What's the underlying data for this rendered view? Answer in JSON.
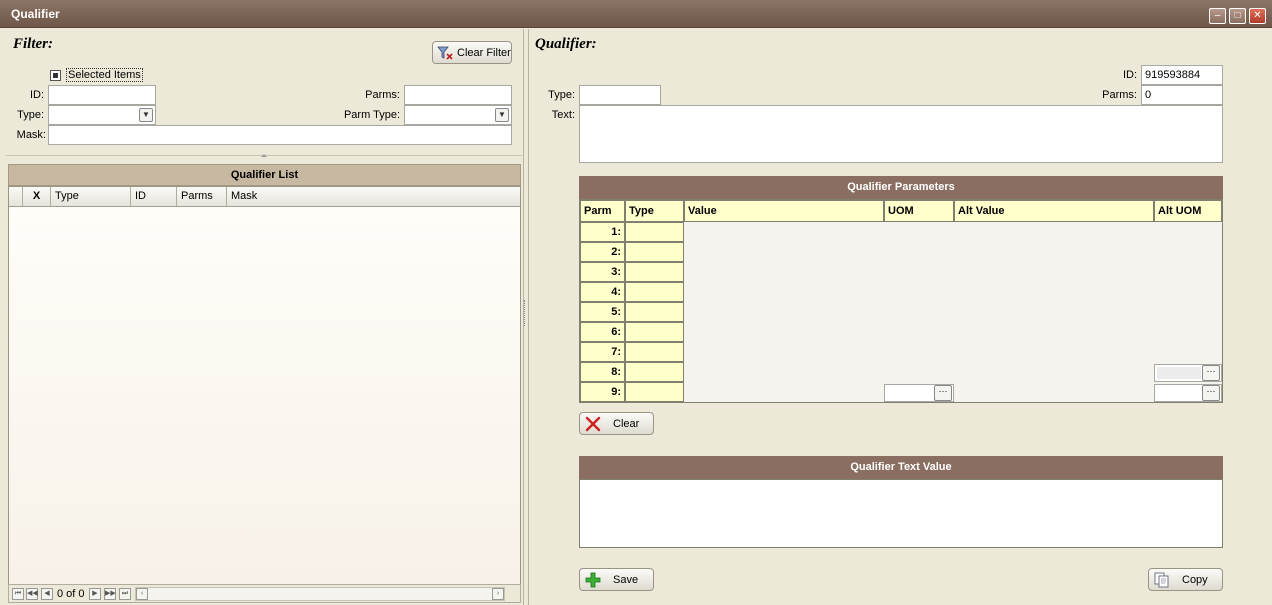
{
  "window": {
    "title": "Qualifier"
  },
  "filter": {
    "heading": "Filter:",
    "clear_filter_label": "Clear Filter",
    "selected_items_label": "Selected Items",
    "id_label": "ID:",
    "type_label": "Type:",
    "mask_label": "Mask:",
    "parms_label": "Parms:",
    "parm_type_label": "Parm Type:",
    "id_value": "",
    "type_value": "",
    "mask_value": "",
    "parms_value": "",
    "parm_type_value": ""
  },
  "qualifier_list": {
    "title": "Qualifier List",
    "columns": [
      "X",
      "Type",
      "ID",
      "Parms",
      "Mask"
    ],
    "rows": [],
    "pager_text": "0 of 0"
  },
  "qualifier": {
    "heading": "Qualifier:",
    "id_label": "ID:",
    "id_value": "919593884",
    "type_label": "Type:",
    "type_value": "",
    "parms_label": "Parms:",
    "parms_value": "0",
    "text_label": "Text:",
    "text_value": ""
  },
  "parameters": {
    "title": "Qualifier Parameters",
    "columns": [
      "Parm",
      "Type",
      "Value",
      "UOM",
      "Alt Value",
      "Alt UOM"
    ],
    "rows": [
      "1:",
      "2:",
      "3:",
      "4:",
      "5:",
      "6:",
      "7:",
      "8:",
      "9:"
    ],
    "clear_label": "Clear"
  },
  "text_value": {
    "title": "Qualifier Text Value",
    "value": ""
  },
  "actions": {
    "save_label": "Save",
    "copy_label": "Copy"
  },
  "icons": {
    "minimize": "minimize-icon",
    "maximize": "maximize-icon",
    "close": "close-icon",
    "clear_filter": "funnel-clear-icon",
    "clear": "red-x-icon",
    "save": "green-plus-icon",
    "copy": "copy-documents-icon"
  },
  "colors": {
    "title_bar": "#7a6254",
    "section_header": "#8a6e62",
    "grid_cell": "#ffffcc",
    "panel": "#ece9d8"
  }
}
